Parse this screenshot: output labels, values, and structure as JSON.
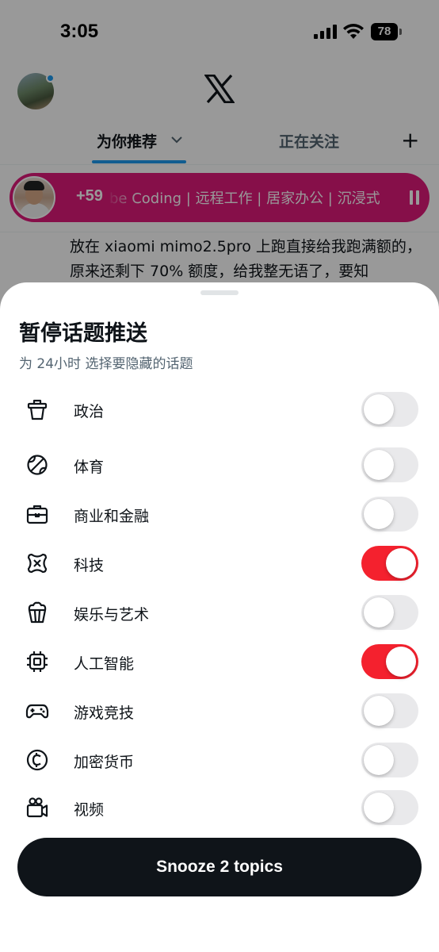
{
  "status_bar": {
    "time": "3:05",
    "battery": "78"
  },
  "header": {
    "logo": "x-logo"
  },
  "tabs": [
    {
      "label": "为你推荐",
      "active": true
    },
    {
      "label": "正在关注",
      "active": false
    }
  ],
  "live_banner": {
    "count": "+59",
    "ticker": "be Coding | 远程工作 | 居家办公 | 沉浸式",
    "color": "#e0197b"
  },
  "tweet": {
    "text": "放在 xiaomi mimo2.5pro 上跑直接给我跑满额的，原来还剩下 70% 额度，给我整无语了，要知"
  },
  "sheet": {
    "title": "暂停话题推送",
    "subtitle": "为 24小时 选择要隐藏的话题",
    "topics": [
      {
        "label": "政治",
        "icon": "podium-icon",
        "enabled": false
      },
      {
        "label": "体育",
        "icon": "ball-icon",
        "enabled": false
      },
      {
        "label": "商业和金融",
        "icon": "briefcase-icon",
        "enabled": false
      },
      {
        "label": "科技",
        "icon": "tech-icon",
        "enabled": true
      },
      {
        "label": "娱乐与艺术",
        "icon": "popcorn-icon",
        "enabled": false
      },
      {
        "label": "人工智能",
        "icon": "chip-icon",
        "enabled": true
      },
      {
        "label": "游戏竞技",
        "icon": "gamepad-icon",
        "enabled": false
      },
      {
        "label": "加密货币",
        "icon": "crypto-coin-icon",
        "enabled": false
      },
      {
        "label": "视频",
        "icon": "video-camera-icon",
        "enabled": false
      }
    ],
    "button_label": "Snooze 2 topics"
  },
  "colors": {
    "toggle_on": "#f4212e",
    "toggle_off": "#e9e9eb",
    "accent": "#1d9bf0",
    "button_bg": "#0f1419"
  }
}
